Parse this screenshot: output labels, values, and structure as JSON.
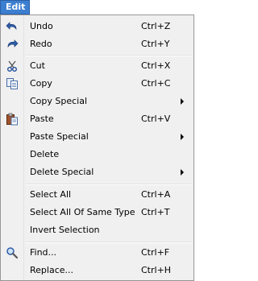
{
  "menubar": {
    "title": "Edit"
  },
  "items": {
    "undo": {
      "label": "Undo",
      "shortcut": "Ctrl+Z"
    },
    "redo": {
      "label": "Redo",
      "shortcut": "Ctrl+Y"
    },
    "cut": {
      "label": "Cut",
      "shortcut": "Ctrl+X"
    },
    "copy": {
      "label": "Copy",
      "shortcut": "Ctrl+C"
    },
    "copy_special": {
      "label": "Copy Special"
    },
    "paste": {
      "label": "Paste",
      "shortcut": "Ctrl+V"
    },
    "paste_special": {
      "label": "Paste Special"
    },
    "delete": {
      "label": "Delete"
    },
    "delete_special": {
      "label": "Delete Special"
    },
    "select_all": {
      "label": "Select All",
      "shortcut": "Ctrl+A"
    },
    "select_same_type": {
      "label": "Select All Of Same Type",
      "shortcut": "Ctrl+T"
    },
    "invert_selection": {
      "label": "Invert Selection"
    },
    "find": {
      "label": "Find...",
      "shortcut": "Ctrl+F"
    },
    "replace": {
      "label": "Replace...",
      "shortcut": "Ctrl+H"
    }
  },
  "icons": {
    "undo": "undo-arrow-icon",
    "redo": "redo-arrow-icon",
    "cut": "scissors-icon",
    "copy": "copy-pages-icon",
    "paste": "clipboard-icon",
    "find": "magnifier-icon"
  },
  "colors": {
    "menubar_highlight": "#3c7fd0",
    "menu_background": "#f0f0f0",
    "undo_icon": "#2f5ea8"
  }
}
